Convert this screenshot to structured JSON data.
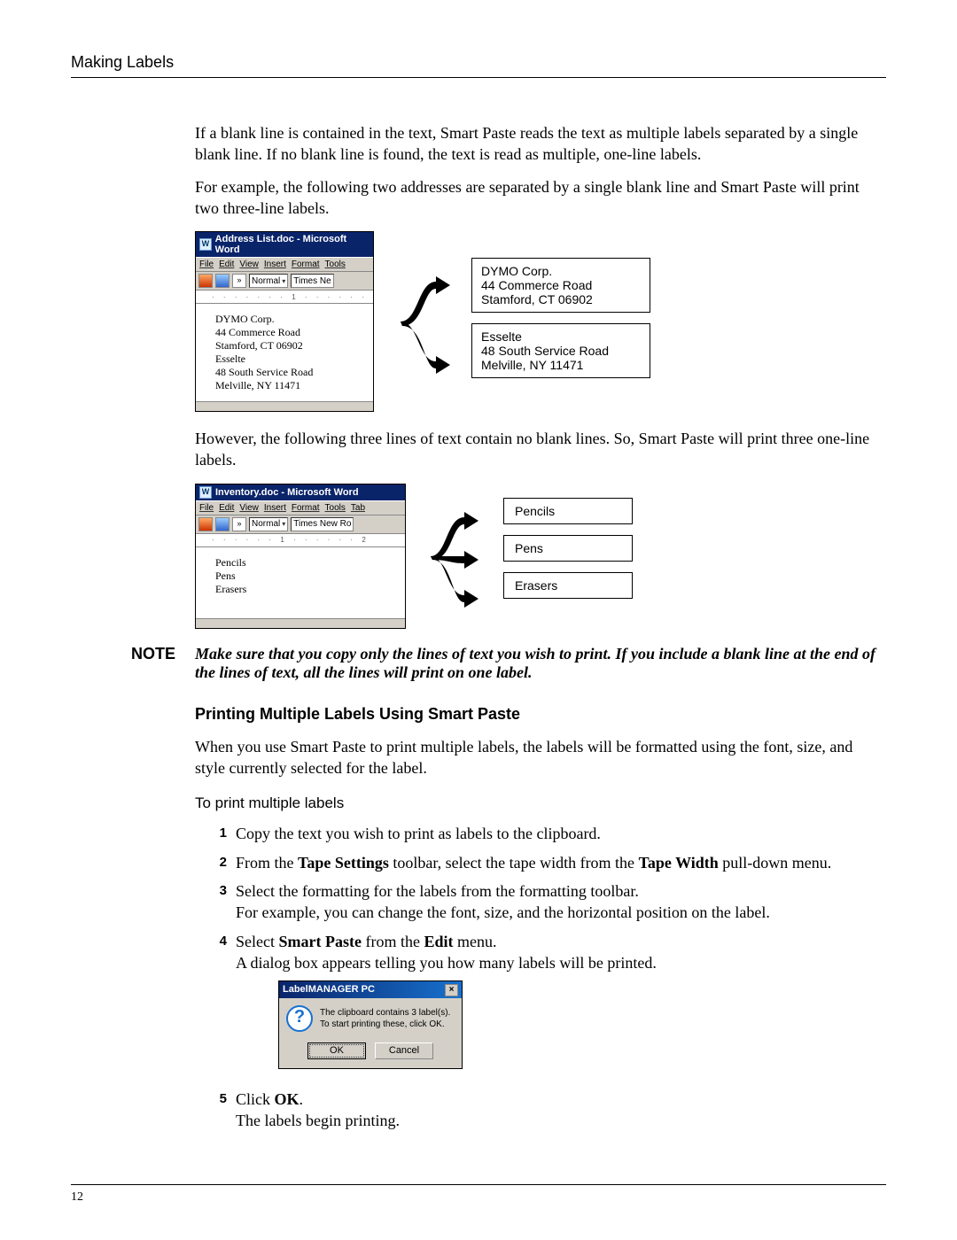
{
  "header": "Making Labels",
  "page_number": "12",
  "p1": "If a blank line is contained in the text, Smart Paste reads the text as multiple labels separated by a single blank line. If no blank line is found, the text is read as multiple, one-line labels.",
  "p2": "For example, the following two addresses are separated by a single blank line and Smart Paste will print two three-line labels.",
  "fig1": {
    "title": "Address List.doc - Microsoft Word",
    "menu": [
      "File",
      "Edit",
      "View",
      "Insert",
      "Format",
      "Tools"
    ],
    "style_combo": "Normal",
    "font_combo": "Times Ne",
    "ruler": "· · · · · · · 1 · · · · · ·",
    "doc_lines": [
      "DYMO Corp.",
      "44 Commerce Road",
      "Stamford, CT 06902",
      "",
      "Esselte",
      "48 South Service Road",
      "Melville, NY 11471"
    ],
    "labels": [
      "DYMO Corp.\n44 Commerce Road\nStamford, CT 06902",
      "Esselte\n48 South Service Road\nMelville, NY 11471"
    ]
  },
  "p3": "However, the following three lines of text contain no blank lines. So, Smart Paste will print three one-line labels.",
  "fig2": {
    "title": "Inventory.doc - Microsoft Word",
    "menu": [
      "File",
      "Edit",
      "View",
      "Insert",
      "Format",
      "Tools",
      "Tab"
    ],
    "style_combo": "Normal",
    "font_combo": "Times New Ro",
    "ruler": "· · · · · · 1 · · · · · · 2",
    "doc_lines": [
      "Pencils",
      "Pens",
      "Erasers"
    ],
    "labels": [
      "Pencils",
      "Pens",
      "Erasers"
    ]
  },
  "note": {
    "label": "NOTE",
    "text": "Make sure that you copy only the lines of text you wish to print. If you include a blank line at the end of the lines of text, all the lines will print on one label."
  },
  "section_heading": "Printing Multiple Labels Using Smart Paste",
  "p4": "When you use Smart Paste to print multiple labels, the labels will be formatted using the font, size, and style currently selected for the label.",
  "task_heading": "To print multiple labels",
  "steps": {
    "s1": "Copy the text you wish to print as labels to the clipboard.",
    "s2a": "From the ",
    "s2b": "Tape Settings",
    "s2c": " toolbar, select the tape width from the ",
    "s2d": "Tape Width",
    "s2e": " pull-down menu.",
    "s3a": "Select the formatting for the labels from the formatting toolbar.",
    "s3b": "For example, you can change the font, size, and the horizontal position on the label.",
    "s4a": "Select ",
    "s4b": "Smart Paste",
    "s4c": " from the ",
    "s4d": "Edit",
    "s4e": " menu.",
    "s4f": "A dialog box appears telling you how many labels will be printed.",
    "s5a": "Click ",
    "s5b": "OK",
    "s5c": ".",
    "s5d": "The labels begin printing."
  },
  "dialog": {
    "title": "LabelMANAGER PC",
    "line1": "The clipboard contains 3 label(s).",
    "line2": "To start printing these, click OK.",
    "ok": "OK",
    "cancel": "Cancel"
  }
}
